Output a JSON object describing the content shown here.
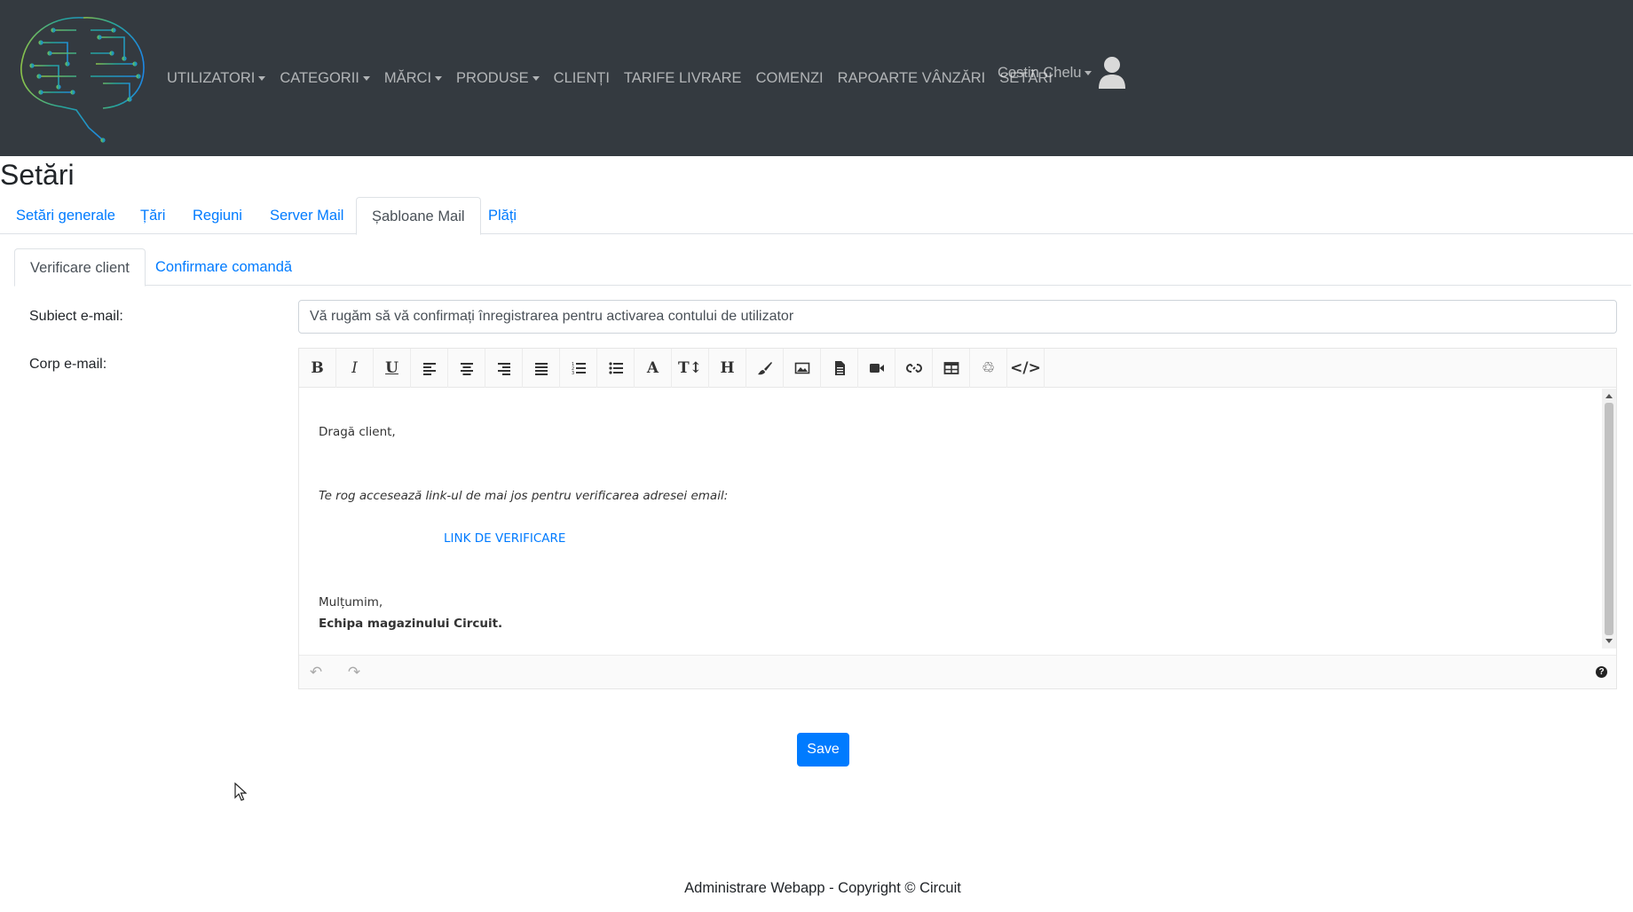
{
  "nav": {
    "items": [
      {
        "label": "UTILIZATORI",
        "dropdown": true
      },
      {
        "label": "CATEGORII",
        "dropdown": true
      },
      {
        "label": "MĂRCI",
        "dropdown": true
      },
      {
        "label": "PRODUSE",
        "dropdown": true
      },
      {
        "label": "CLIENȚI",
        "dropdown": false
      },
      {
        "label": "TARIFE LIVRARE",
        "dropdown": false
      },
      {
        "label": "COMENZI",
        "dropdown": false
      },
      {
        "label": "RAPOARTE VÂNZĂRI",
        "dropdown": false
      },
      {
        "label": "SETĂRI",
        "dropdown": false
      }
    ],
    "user": "Costin Chelu"
  },
  "page": {
    "title": "Setări"
  },
  "tabs": [
    "Setări generale",
    "Țări",
    "Regiuni",
    "Server Mail",
    "Șabloane Mail",
    "Plăți"
  ],
  "active_tab": "Șabloane Mail",
  "subtabs": [
    "Verificare client",
    "Confirmare comandă"
  ],
  "active_subtab": "Verificare client",
  "form": {
    "subject_label": "Subiect e-mail:",
    "subject_value": "Vă rugăm să vă confirmați înregistrarea pentru activarea contului de utilizator",
    "body_label": "Corp e-mail:"
  },
  "editor": {
    "toolbar": [
      "bold-icon",
      "italic-icon",
      "underline-icon",
      "align-left-icon",
      "align-center-icon",
      "align-right-icon",
      "align-justify-icon",
      "ordered-list-icon",
      "unordered-list-icon",
      "font-color-icon",
      "font-size-icon",
      "heading-icon",
      "brush-icon",
      "image-icon",
      "file-icon",
      "video-icon",
      "link-icon",
      "table-icon",
      "recycle-icon",
      "code-icon"
    ],
    "greeting": "Dragă client,",
    "instruction": "Te rog accesează link-ul de mai jos pentru verificarea adresei email:",
    "link_text": "LINK DE VERIFICARE",
    "thanks": "Mulțumim,",
    "signature": "Echipa magazinului Circuit."
  },
  "save_label": "Save",
  "footer": "Administrare Webapp - Copyright © Circuit",
  "colors": {
    "navbar": "#343a40",
    "link": "#007bff",
    "primary_button": "#007bff"
  }
}
